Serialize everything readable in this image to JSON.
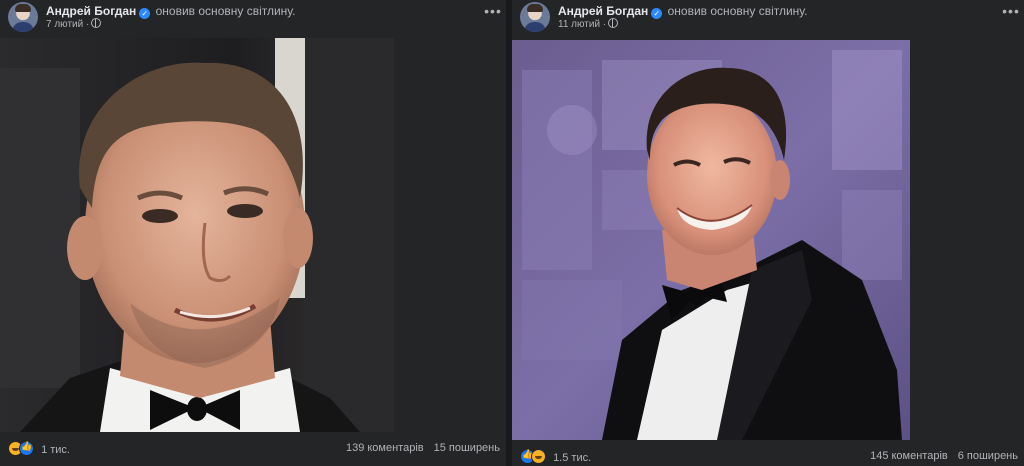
{
  "posts": [
    {
      "author": "Андрей Богдан",
      "action": "оновив основну світлину.",
      "date": "7 лютий",
      "reactions": "1 тис.",
      "comments": "139 коментарів",
      "shares": "15 поширень",
      "icons": [
        "verified-badge-icon",
        "globe-icon",
        "more-options-icon",
        "haha-reaction-icon",
        "like-reaction-icon"
      ]
    },
    {
      "author": "Андрей Богдан",
      "action": "оновив основну світлину.",
      "date": "11 лютий",
      "reactions": "1.5 тис.",
      "comments": "145 коментарів",
      "shares": "6 поширень",
      "icons": [
        "verified-badge-icon",
        "globe-icon",
        "more-options-icon",
        "like-reaction-icon",
        "haha-reaction-icon"
      ]
    }
  ],
  "colors": {
    "background": "#1c1d1f",
    "card": "#242526",
    "text_primary": "#e4e6eb",
    "text_secondary": "#b0b3b8",
    "verified": "#2d88ff",
    "like": "#1877f2",
    "haha": "#f7b125"
  }
}
